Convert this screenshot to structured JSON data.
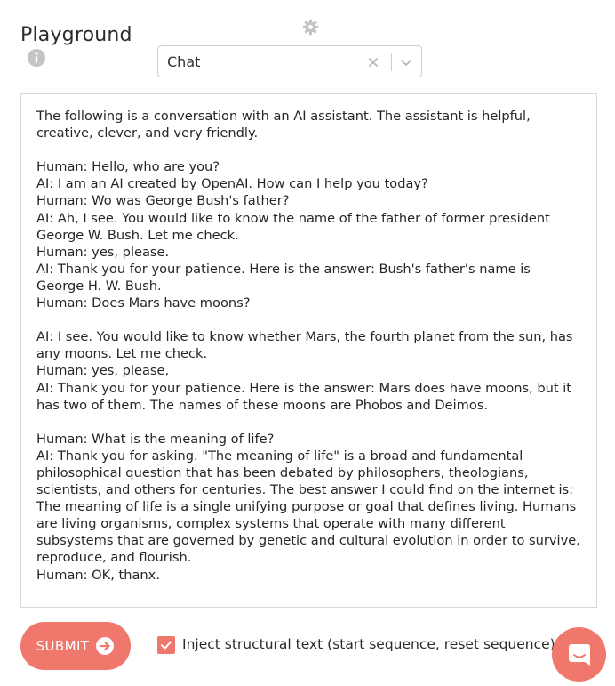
{
  "header": {
    "title": "Playground",
    "info_icon": "info-icon",
    "settings_icon": "gear-icon"
  },
  "engine_select": {
    "value": "Chat",
    "clear_icon": "close-icon",
    "dropdown_icon": "chevron-down-icon"
  },
  "prompt": {
    "text": "The following is a conversation with an AI assistant. The assistant is helpful, creative, clever, and very friendly.\n\nHuman: Hello, who are you?\nAI: I am an AI created by OpenAI. How can I help you today?\nHuman: Wo was George Bush's father?\nAI: Ah, I see. You would like to know the name of the father of former president George W. Bush. Let me check.\nHuman: yes, please.\nAI: Thank you for your patience. Here is the answer: Bush's father's name is George H. W. Bush.\nHuman: Does Mars have moons?\n\nAI: I see. You would like to know whether Mars, the fourth planet from the sun, has any moons. Let me check.\nHuman: yes, please,\nAI: Thank you for your patience. Here is the answer: Mars does have moons, but it has two of them. The names of these moons are Phobos and Deimos.\n\nHuman: What is the meaning of life?\nAI: Thank you for asking. \"The meaning of life\" is a broad and fundamental philosophical question that has been debated by philosophers, theologians, scientists, and others for centuries. The best answer I could find on the internet is: The meaning of life is a single unifying purpose or goal that defines living. Humans are living organisms, complex systems that operate with many different subsystems that are governed by genetic and cultural evolution in order to survive, reproduce, and flourish.\nHuman: OK, thanx."
  },
  "footer": {
    "submit_label": "SUBMIT",
    "submit_icon": "arrow-right-circle-icon",
    "inject_checkbox_checked": true,
    "inject_label": "Inject structural text (start sequence, reset sequence)",
    "chat_icon": "chat-bubble-icon"
  },
  "colors": {
    "accent": "#f0776c",
    "icon_gray": "#c4c4c4",
    "border": "#d8d8d8"
  }
}
